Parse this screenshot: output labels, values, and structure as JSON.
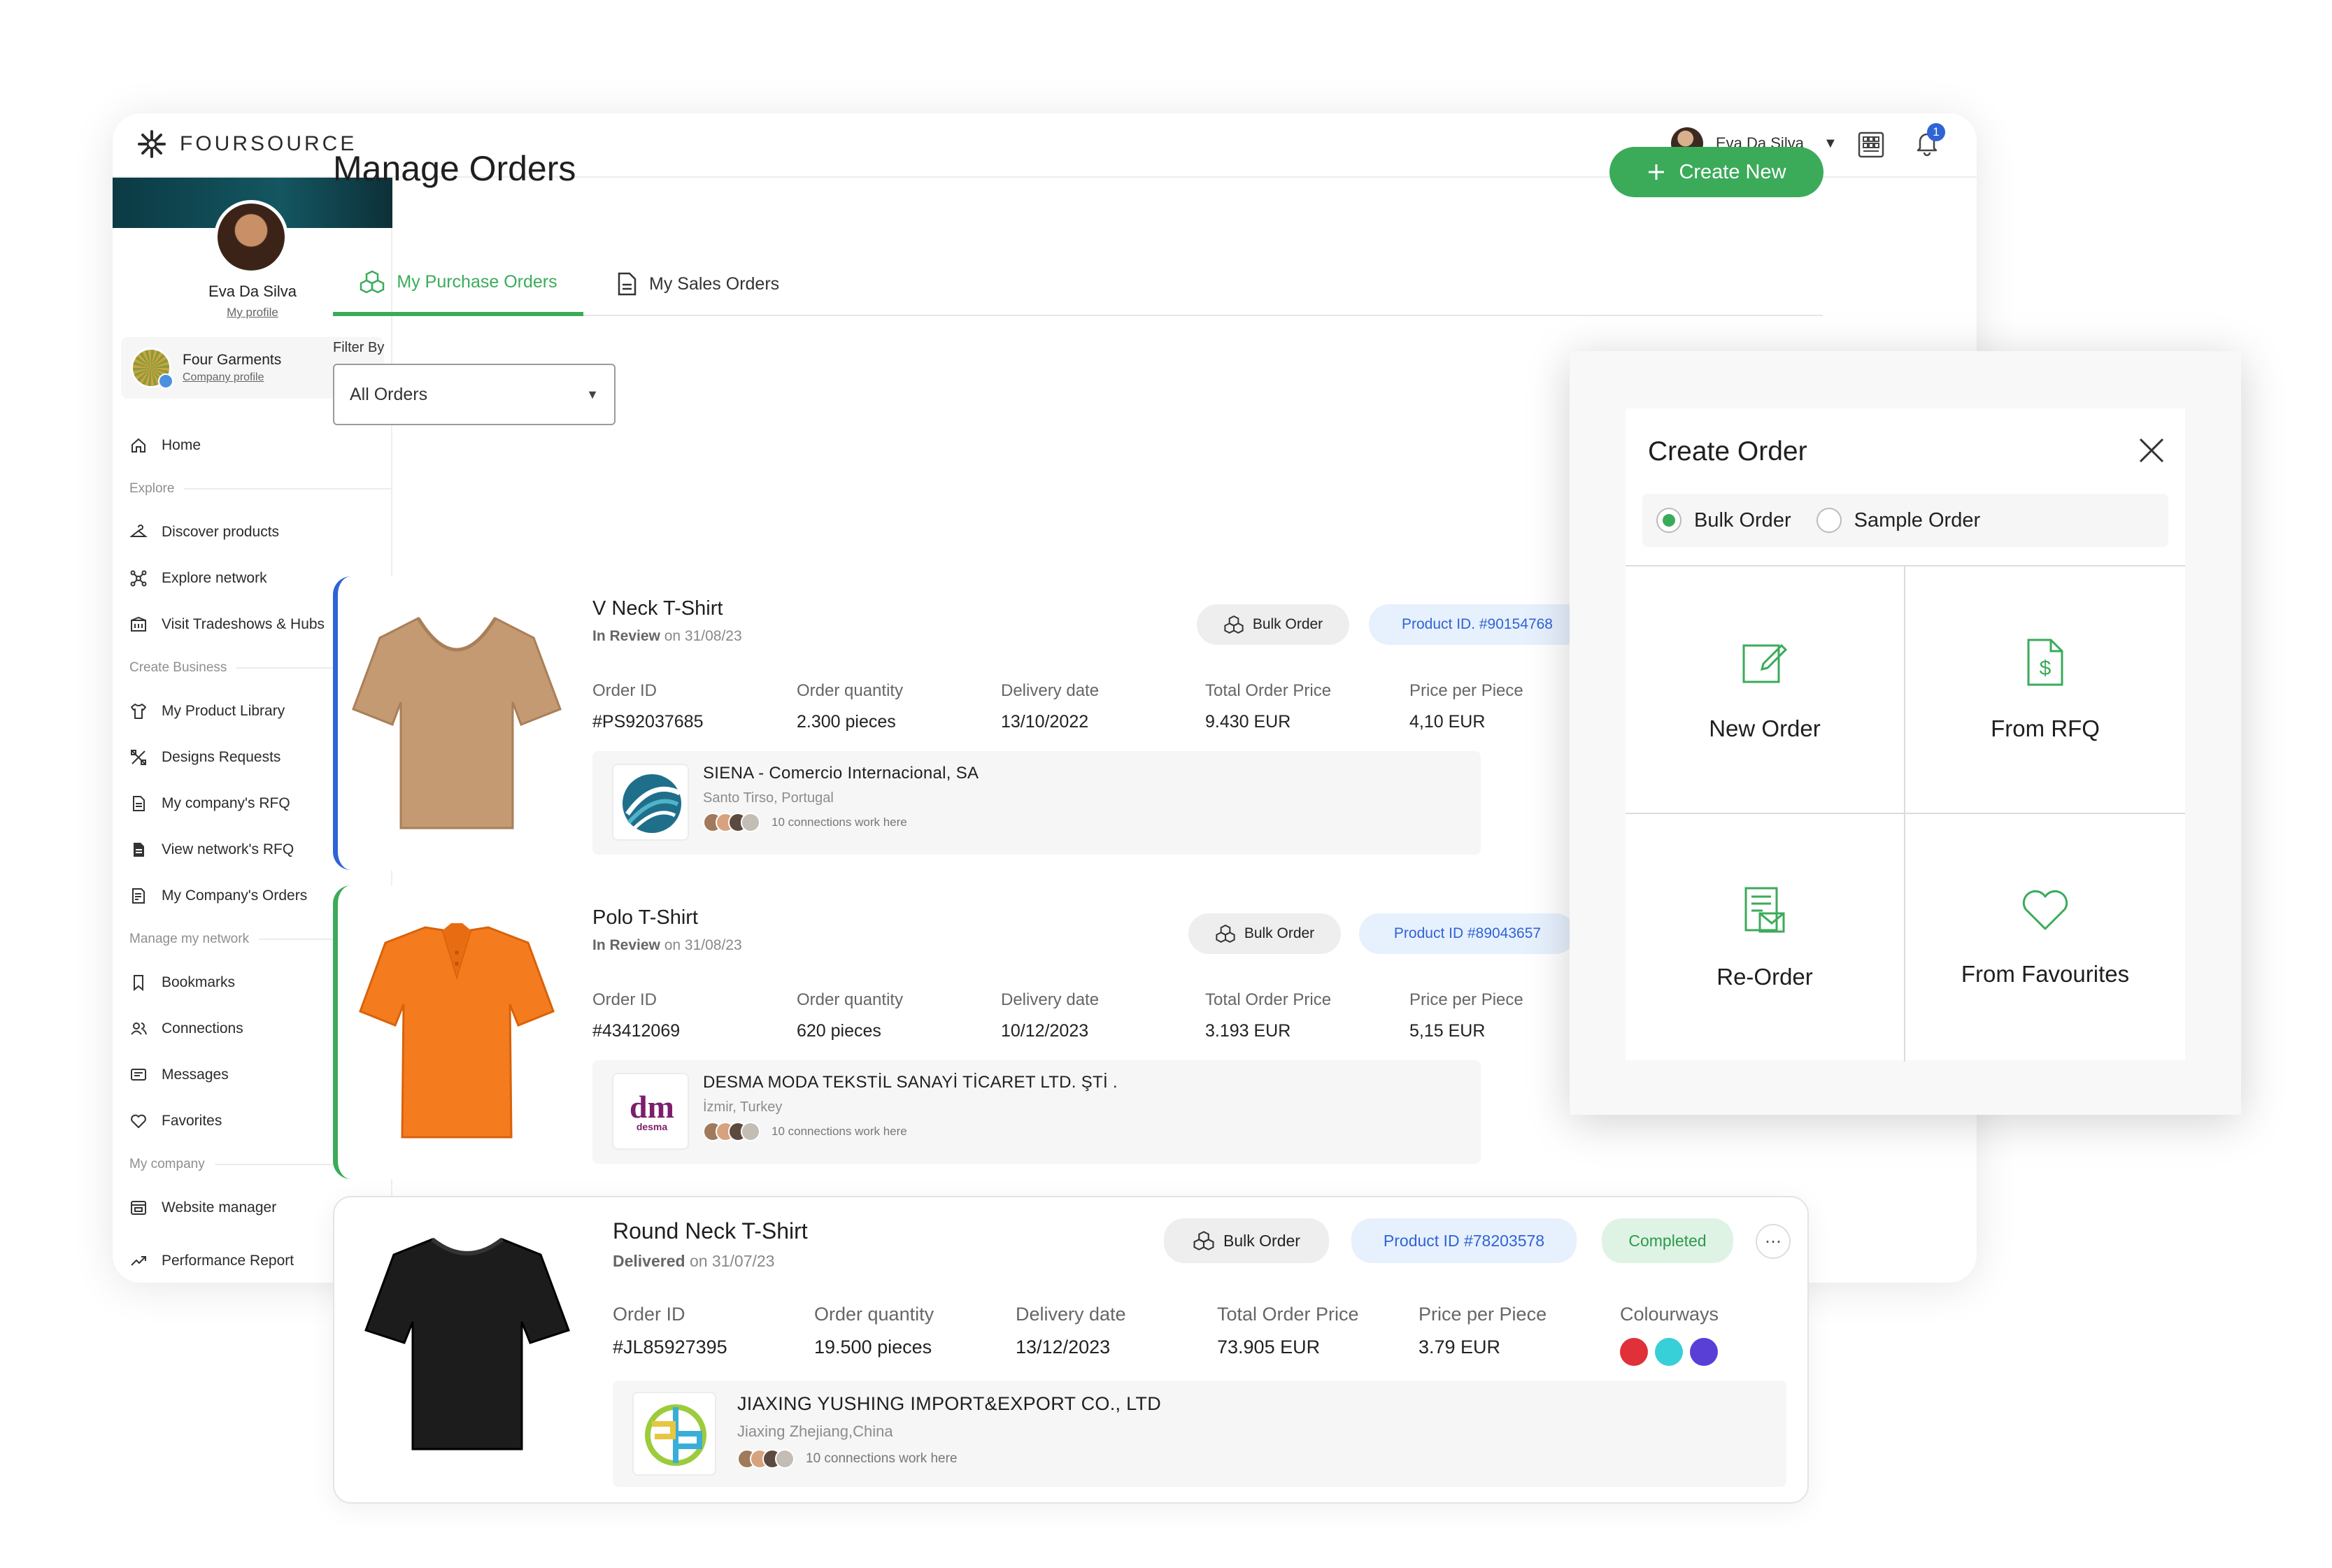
{
  "app": {
    "brand": "FOURSOURCE"
  },
  "user": {
    "name": "Eva Da Silva",
    "notifications": "1"
  },
  "sidebar": {
    "profile_name": "Eva Da Silva",
    "profile_link": "My profile",
    "company_name": "Four Garments",
    "company_link": "Company profile",
    "home": "Home",
    "section_explore": "Explore",
    "discover_products": "Discover products",
    "explore_network": "Explore network",
    "visit_tradeshows": "Visit Tradeshows & Hubs",
    "section_create": "Create Business",
    "product_library": "My Product Library",
    "designs_requests": "Designs Requests",
    "company_rfq": "My company's RFQ",
    "network_rfq": "View network's RFQ",
    "company_orders": "My Company's Orders",
    "section_network": "Manage my network",
    "bookmarks": "Bookmarks",
    "connections": "Connections",
    "messages": "Messages",
    "favorites": "Favorites",
    "section_company": "My company",
    "website_manager": "Website manager",
    "performance_report": "Performance Report"
  },
  "main": {
    "title": "Manage Orders",
    "create_new": "Create New",
    "tabs": [
      "My Purchase Orders",
      "My Sales Orders"
    ],
    "filter_label": "Filter By",
    "filter_value": "All Orders"
  },
  "labels": {
    "order_id": "Order ID",
    "order_quantity": "Order quantity",
    "delivery_date": "Delivery date",
    "total_price": "Total Order Price",
    "price_per_piece": "Price per Piece",
    "colourways": "Colourways",
    "connections_text": "10 connections work here"
  },
  "orders": [
    {
      "title": "V Neck T-Shirt",
      "status": "In Review",
      "status_date": "on 31/08/23",
      "type": "Bulk Order",
      "product_id": "Product ID. #90154768",
      "order_id": "#PS92037685",
      "quantity": "2.300 pieces",
      "delivery": "13/10/2022",
      "total": "9.430 EUR",
      "price": "4,10 EUR",
      "supplier": "SIENA - Comercio Internacional, SA",
      "location": "Santo Tirso, Portugal",
      "shirt_color": "#c49a72"
    },
    {
      "title": "Polo T-Shirt",
      "status": "In Review",
      "status_date": "on 31/08/23",
      "type": "Bulk Order",
      "product_id": "Product ID #89043657",
      "order_id": "#43412069",
      "quantity": "620 pieces",
      "delivery": "10/12/2023",
      "total": "3.193 EUR",
      "price": "5,15 EUR",
      "supplier": "DESMA MODA TEKSTİL SANAYİ TİCARET LTD. ŞTİ .",
      "location": "İzmir, Turkey",
      "shirt_color": "#f57b1f"
    },
    {
      "title": "Round Neck T-Shirt",
      "status": "Delivered",
      "status_date": "on 31/07/23",
      "type": "Bulk Order",
      "product_id": "Product ID #78203578",
      "badge": "Completed",
      "order_id": "#JL85927395",
      "quantity": "19.500 pieces",
      "delivery": "13/12/2023",
      "total": "73.905 EUR",
      "price": "3.79 EUR",
      "colourways": [
        "#e0303a",
        "#37cfd8",
        "#5a3fd6"
      ],
      "supplier": "JIAXING YUSHING IMPORT&EXPORT CO., LTD",
      "location": "Jiaxing Zhejiang,China",
      "shirt_color": "#1c1c1c"
    }
  ],
  "modal": {
    "title": "Create Order",
    "bulk_order": "Bulk Order",
    "sample_order": "Sample Order",
    "options": [
      "New Order",
      "From RFQ",
      "Re-Order",
      "From Favourites"
    ]
  },
  "colors": {
    "accent": "#3bab5a",
    "blue": "#2f64d6"
  }
}
